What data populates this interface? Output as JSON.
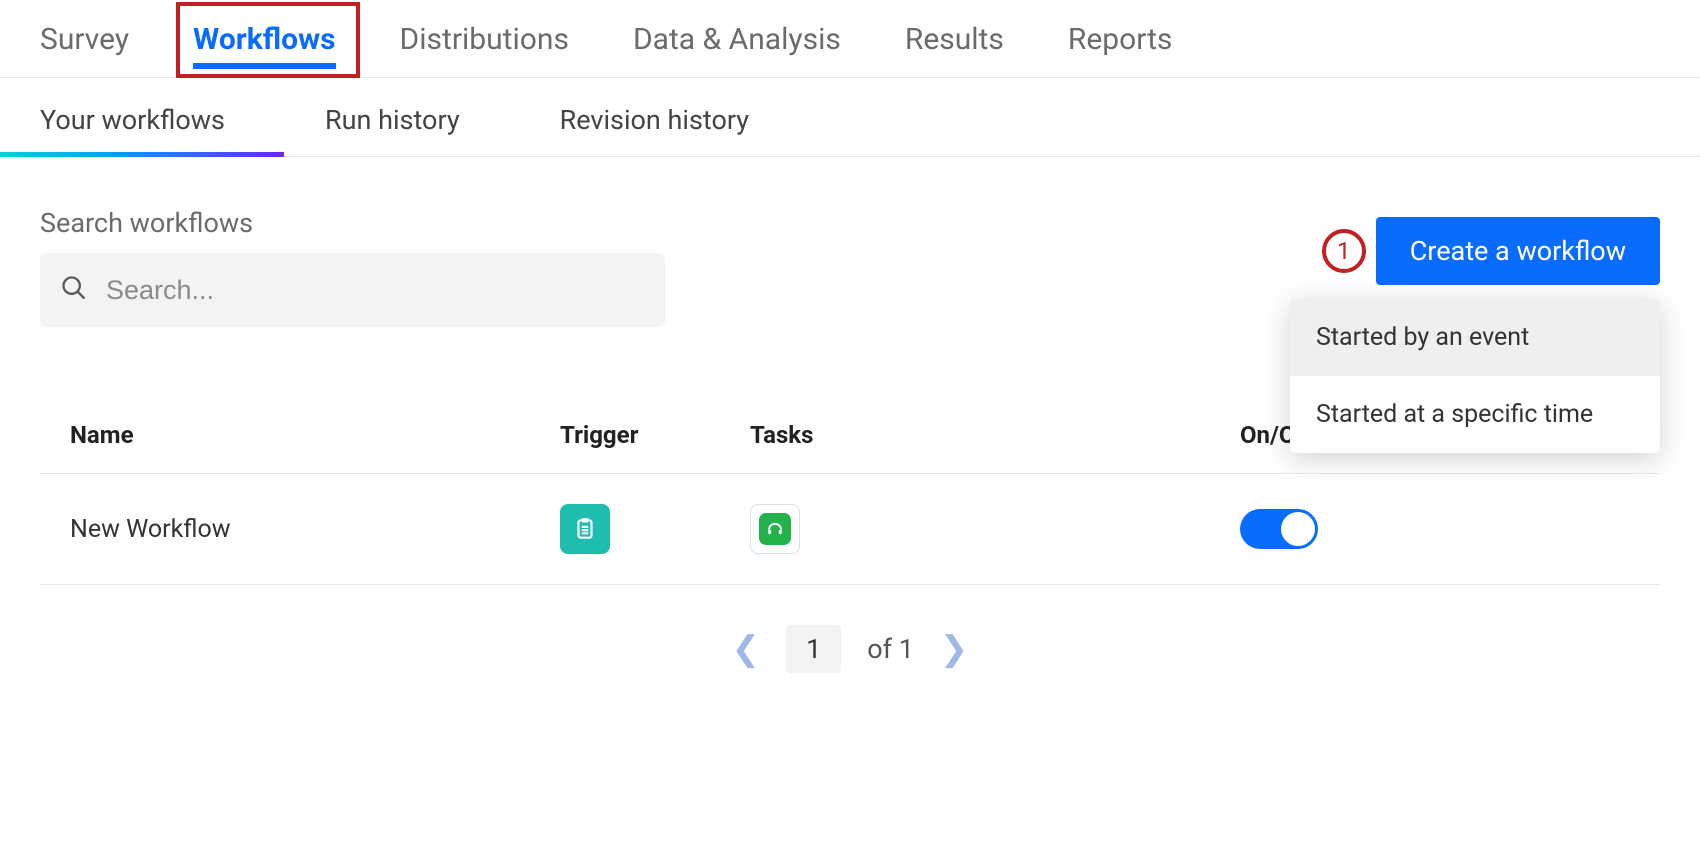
{
  "top_tabs": {
    "items": [
      "Survey",
      "Workflows",
      "Distributions",
      "Data & Analysis",
      "Results",
      "Reports"
    ],
    "active_index": 1
  },
  "sub_tabs": {
    "items": [
      "Your workflows",
      "Run history",
      "Revision history"
    ],
    "active_index": 0
  },
  "search": {
    "label": "Search workflows",
    "placeholder": "Search..."
  },
  "create_button": {
    "label": "Create a workflow",
    "annotation_number": "1",
    "dropdown": [
      "Started by an event",
      "Started at a specific time"
    ]
  },
  "table": {
    "columns": {
      "name": "Name",
      "trigger": "Trigger",
      "tasks": "Tasks",
      "onoff": "On/Off"
    },
    "rows": [
      {
        "name": "New Workflow",
        "trigger_icon": "clipboard-icon",
        "task_icon": "freshdesk-icon",
        "on": true
      }
    ]
  },
  "pagination": {
    "current": "1",
    "total_label": "of 1"
  }
}
